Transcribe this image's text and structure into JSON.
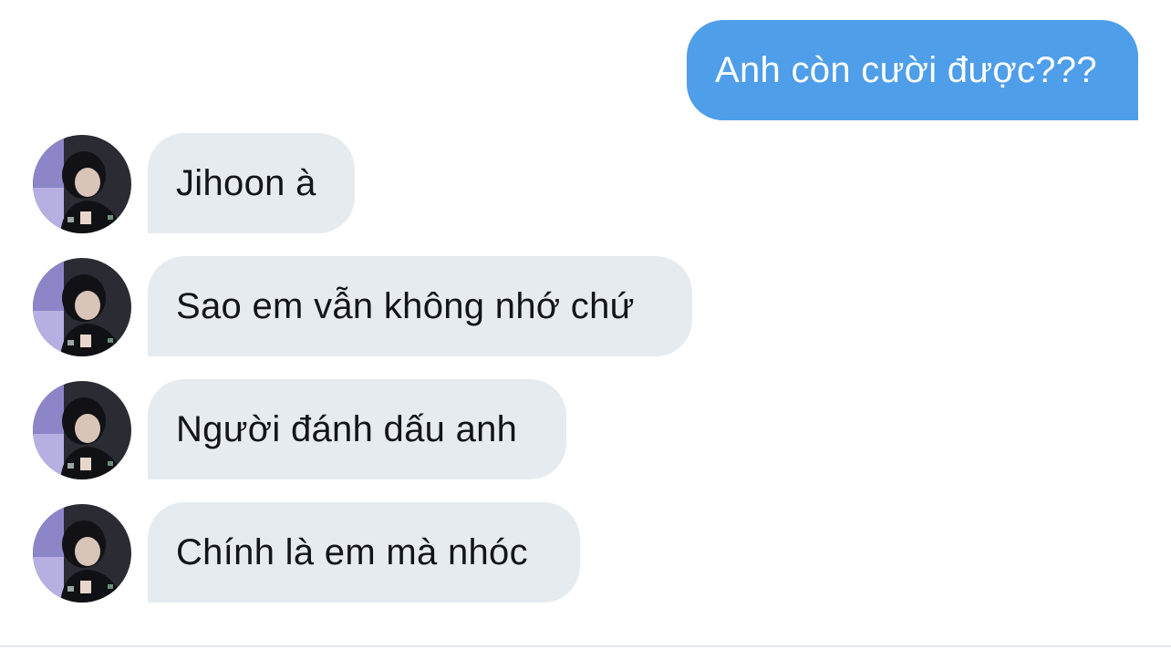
{
  "conversation": {
    "sent": [
      {
        "text": "Anh còn cười được???"
      }
    ],
    "received": [
      {
        "text": "Jihoon à"
      },
      {
        "text": "Sao em vẫn không nhớ chứ"
      },
      {
        "text": "Người đánh dấu anh"
      },
      {
        "text": "Chính là em mà nhóc"
      }
    ]
  },
  "colors": {
    "sent_bubble": "#4f9ee9",
    "received_bubble": "#e6ebef",
    "received_text": "#111419",
    "background": "#ffffff"
  },
  "avatar_icon": "profile-photo"
}
